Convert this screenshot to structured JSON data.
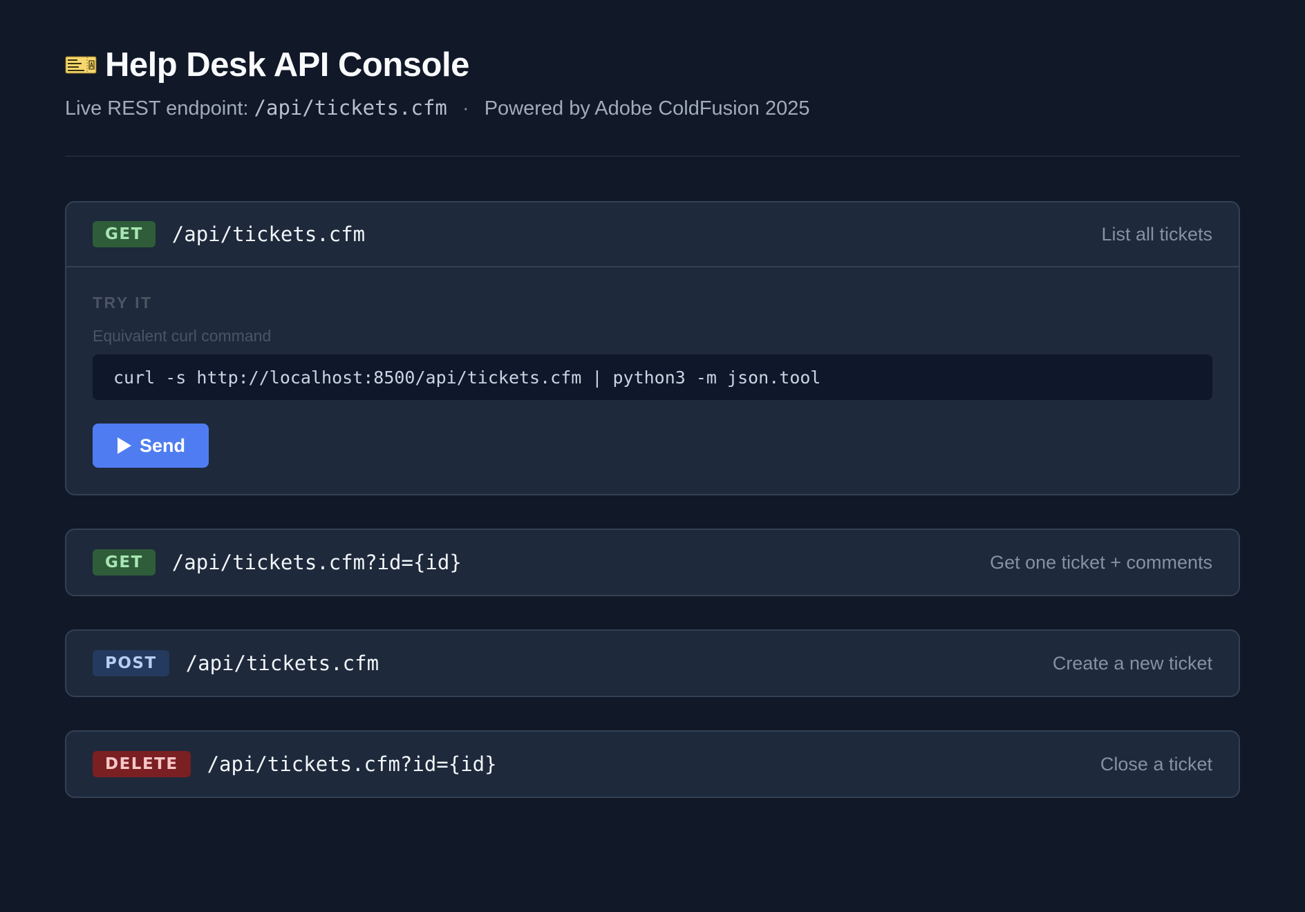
{
  "header": {
    "icon": "ticket-icon",
    "title": "Help Desk API Console",
    "subtitle_prefix": "Live REST endpoint:",
    "subtitle_endpoint": "/api/tickets.cfm",
    "subtitle_separator": "·",
    "subtitle_suffix": "Powered by Adobe ColdFusion 2025"
  },
  "endpoints": [
    {
      "method": "GET",
      "path": "/api/tickets.cfm",
      "description": "List all tickets",
      "expanded": true,
      "try_label": "TRY IT",
      "curl_label": "Equivalent curl command",
      "curl_command": "curl -s http://localhost:8500/api/tickets.cfm | python3 -m json.tool",
      "send_label": "Send"
    },
    {
      "method": "GET",
      "path": "/api/tickets.cfm?id={id}",
      "description": "Get one ticket + comments",
      "expanded": false
    },
    {
      "method": "POST",
      "path": "/api/tickets.cfm",
      "description": "Create a new ticket",
      "expanded": false
    },
    {
      "method": "DELETE",
      "path": "/api/tickets.cfm?id={id}",
      "description": "Close a ticket",
      "expanded": false
    }
  ],
  "colors": {
    "background": "#111827",
    "card": "#1e293b",
    "get_badge": "#2f5d3a",
    "post_badge": "#243a5e",
    "delete_badge": "#7a1f22",
    "send_button": "#4f7df1"
  }
}
